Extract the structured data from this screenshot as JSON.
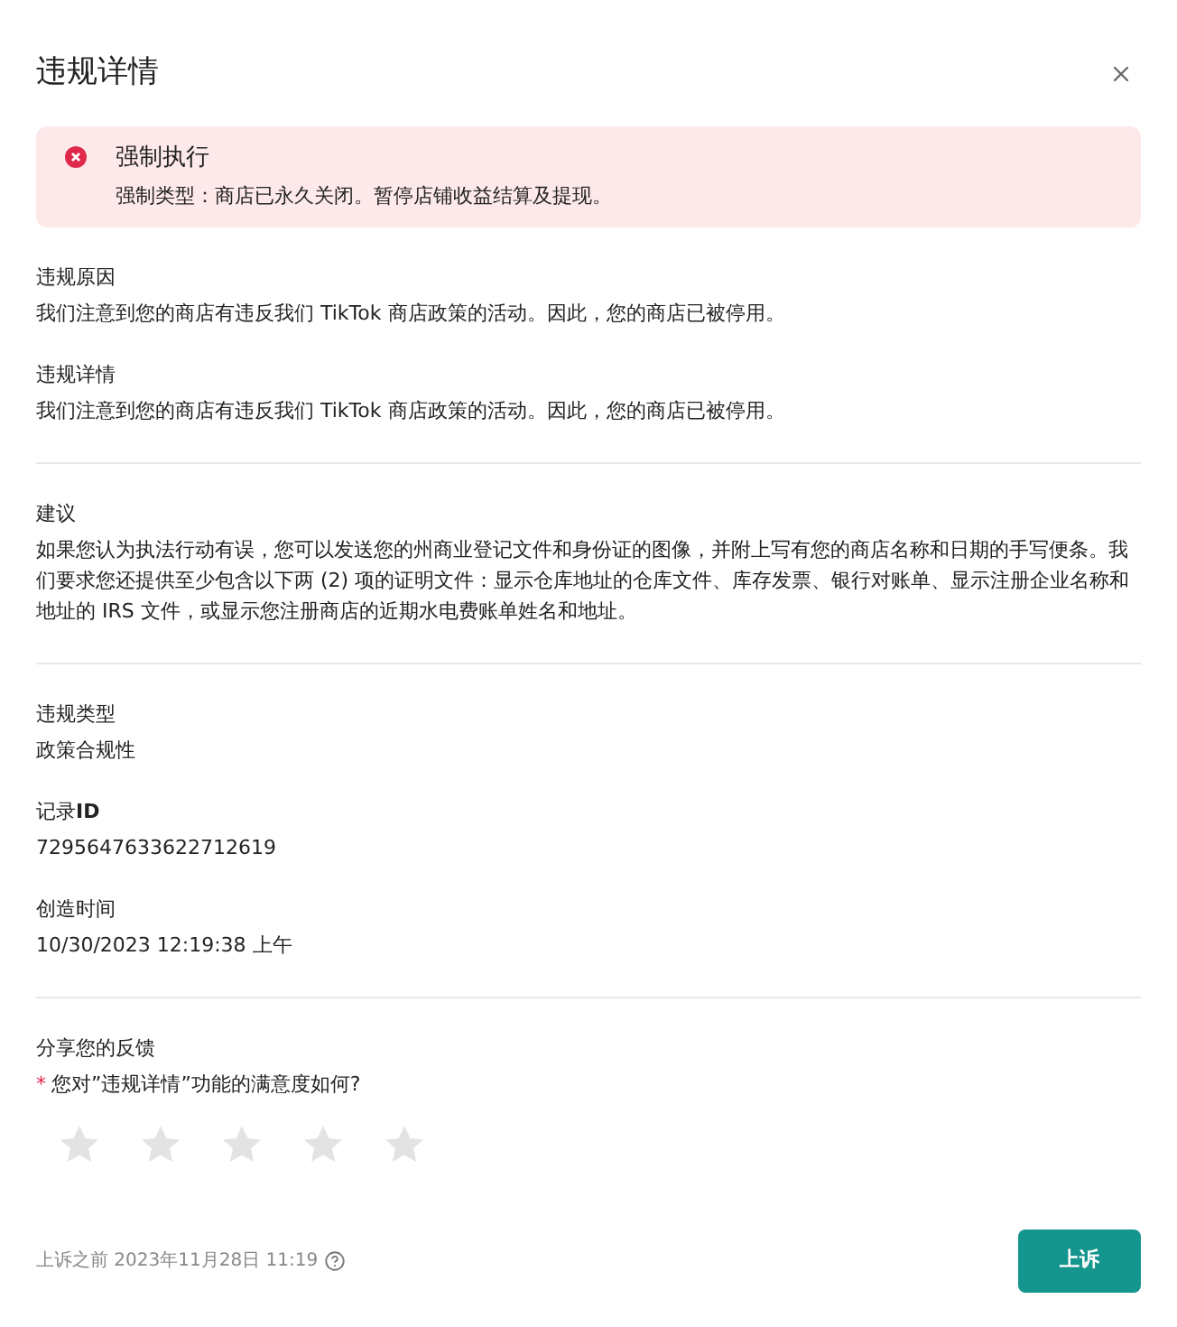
{
  "dialog": {
    "title": "违规详情"
  },
  "alert": {
    "title": "强制执行",
    "text": "强制类型：商店已永久关闭。暂停店铺收益结算及提现。"
  },
  "groups": [
    [
      {
        "label": "违规原因",
        "value": "我们注意到您的商店有违反我们 TikTok 商店政策的活动。因此，您的商店已被停用。"
      },
      {
        "label": "违规详情",
        "value": "我们注意到您的商店有违反我们 TikTok 商店政策的活动。因此，您的商店已被停用。"
      }
    ],
    [
      {
        "label": "建议",
        "value": "如果您认为执法行动有误，您可以发送您的州商业登记文件和身份证的图像，并附上写有您的商店名称和日期的手写便条。我们要求您还提供至少包含以下两 (2) 项的证明文件：显示仓库地址的仓库文件、库存发票、银行对账单、显示注册企业名称和地址的 IRS 文件，或显示您注册商店的近期水电费账单姓名和地址。"
      }
    ],
    [
      {
        "label": "违规类型",
        "value": "政策合规性"
      },
      {
        "label": "记录**ID**",
        "value": "7295647633622712619"
      },
      {
        "label": "创造时间",
        "value": "10/30/2023 12:19:38 上午"
      }
    ]
  ],
  "feedback": {
    "title": "分享您的反馈",
    "required_mark": "*",
    "question": "您对”违规详情”功能的满意度如何?",
    "stars": 0
  },
  "footer": {
    "deadline": "上诉之前 2023年11月28日 11:19",
    "button": "上诉"
  }
}
